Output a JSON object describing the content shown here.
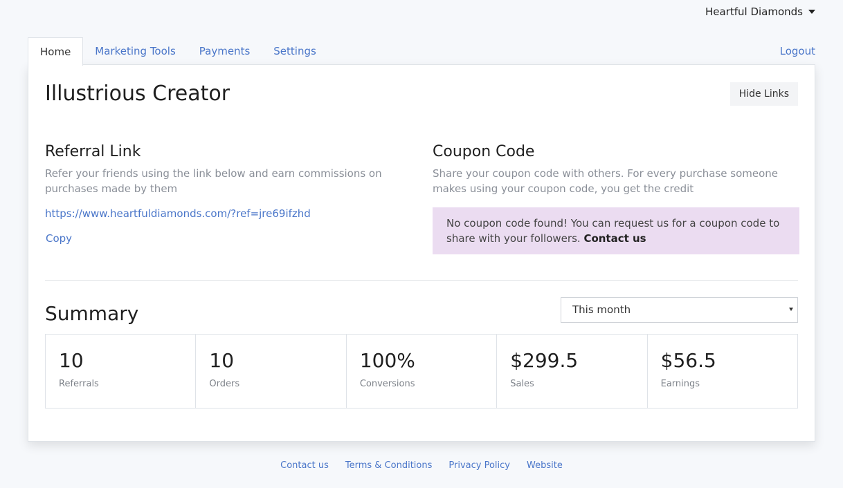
{
  "header": {
    "account_name": "Heartful Diamonds",
    "account_menu_icon": "caret-down-icon"
  },
  "tabs": [
    {
      "label": "Home",
      "active": true
    },
    {
      "label": "Marketing Tools",
      "active": false
    },
    {
      "label": "Payments",
      "active": false
    },
    {
      "label": "Settings",
      "active": false
    }
  ],
  "logout_label": "Logout",
  "main": {
    "title": "Illustrious Creator",
    "hide_links_label": "Hide Links"
  },
  "referral": {
    "heading": "Referral Link",
    "description": "Refer your friends using the link below and earn commissions on purchases made by them",
    "link": "https://www.heartfuldiamonds.com/?ref=jre69ifzhd",
    "copy_label": "Copy"
  },
  "coupon": {
    "heading": "Coupon Code",
    "description": "Share your coupon code with others. For every purchase someone makes using your coupon code, you get the credit",
    "alert_text": "No coupon code found! You can request us for a coupon code to share with your followers.",
    "alert_link": "Contact us",
    "alert_bg": "#ebdcf1"
  },
  "summary": {
    "title": "Summary",
    "period_selected": "This month",
    "stats": [
      {
        "value": "10",
        "label": "Referrals"
      },
      {
        "value": "10",
        "label": "Orders"
      },
      {
        "value": "100%",
        "label": "Conversions"
      },
      {
        "value": "$299.5",
        "label": "Sales"
      },
      {
        "value": "$56.5",
        "label": "Earnings"
      }
    ]
  },
  "footer": {
    "links": [
      "Contact us",
      "Terms & Conditions",
      "Privacy Policy",
      "Website"
    ]
  },
  "colors": {
    "link": "#4a76c9",
    "background": "#f6f8fb"
  }
}
